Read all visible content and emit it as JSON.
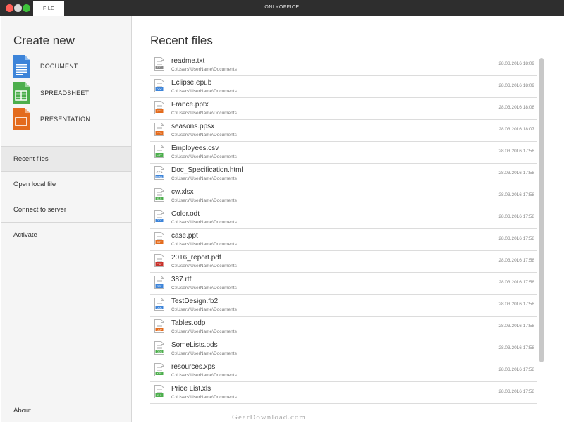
{
  "window": {
    "app_title": "ONLYOFFICE",
    "tab_label": "FILE"
  },
  "sidebar": {
    "create_title": "Create new",
    "create_items": [
      {
        "label": "DOCUMENT",
        "icon": "document-icon",
        "color": "#3d84d9"
      },
      {
        "label": "SPREADSHEET",
        "icon": "spreadsheet-icon",
        "color": "#4cae4c"
      },
      {
        "label": "PRESENTATION",
        "icon": "presentation-icon",
        "color": "#e36b1d"
      }
    ],
    "nav": {
      "recent": "Recent files",
      "open_local": "Open local file",
      "connect": "Connect to server",
      "activate": "Activate"
    },
    "about": "About"
  },
  "main": {
    "title": "Recent files",
    "files": [
      {
        "name": "readme.txt",
        "path": "C:\\Users\\UserName\\Documents",
        "date": "28.03.2016 18:09",
        "badge": "TXT",
        "color": "#888888"
      },
      {
        "name": "Eclipse.epub",
        "path": "C:\\Users\\UserName\\Documents",
        "date": "28.03.2016 18:09",
        "badge": "DOC",
        "color": "#3d84d9"
      },
      {
        "name": "France.pptx",
        "path": "C:\\Users\\UserName\\Documents",
        "date": "28.03.2016 18:08",
        "badge": "PPT",
        "color": "#e36b1d"
      },
      {
        "name": "seasons.ppsx",
        "path": "C:\\Users\\UserName\\Documents",
        "date": "28.03.2016 18:07",
        "badge": "PPS",
        "color": "#e36b1d"
      },
      {
        "name": "Employees.csv",
        "path": "C:\\Users\\UserName\\Documents",
        "date": "28.03.2016 17:58",
        "badge": "CSV",
        "color": "#4cae4c"
      },
      {
        "name": "Doc_Specification.html",
        "path": "C:\\Users\\UserName\\Documents",
        "date": "28.03.2016 17:58",
        "badge": "HTML",
        "color": "#3d84d9"
      },
      {
        "name": "cw.xlsx",
        "path": "C:\\Users\\UserName\\Documents",
        "date": "28.03.2016 17:58",
        "badge": "XLS",
        "color": "#4cae4c"
      },
      {
        "name": "Color.odt",
        "path": "C:\\Users\\UserName\\Documents",
        "date": "28.03.2016 17:58",
        "badge": "ODT",
        "color": "#3d84d9"
      },
      {
        "name": "case.ppt",
        "path": "C:\\Users\\UserName\\Documents",
        "date": "28.03.2016 17:58",
        "badge": "PPT",
        "color": "#e36b1d"
      },
      {
        "name": "2016_report.pdf",
        "path": "C:\\Users\\UserName\\Documents",
        "date": "28.03.2016 17:58",
        "badge": "PDF",
        "color": "#c8302a"
      },
      {
        "name": "387.rtf",
        "path": "C:\\Users\\UserName\\Documents",
        "date": "28.03.2016 17:58",
        "badge": "RTF",
        "color": "#3d84d9"
      },
      {
        "name": "TestDesign.fb2",
        "path": "C:\\Users\\UserName\\Documents",
        "date": "28.03.2016 17:58",
        "badge": "DOC",
        "color": "#3d84d9"
      },
      {
        "name": "Tables.odp",
        "path": "C:\\Users\\UserName\\Documents",
        "date": "28.03.2016 17:58",
        "badge": "ODP",
        "color": "#e36b1d"
      },
      {
        "name": "SomeLists.ods",
        "path": "C:\\Users\\UserName\\Documents",
        "date": "28.03.2016 17:58",
        "badge": "ODS",
        "color": "#4cae4c"
      },
      {
        "name": "resources.xps",
        "path": "C:\\Users\\UserName\\Documents",
        "date": "28.03.2016 17:58",
        "badge": "XPS",
        "color": "#4cae4c"
      },
      {
        "name": "Price List.xls",
        "path": "C:\\Users\\UserName\\Documents",
        "date": "28.03.2016 17:58",
        "badge": "XLS",
        "color": "#4cae4c"
      }
    ]
  },
  "watermark": "GearDownload.com"
}
